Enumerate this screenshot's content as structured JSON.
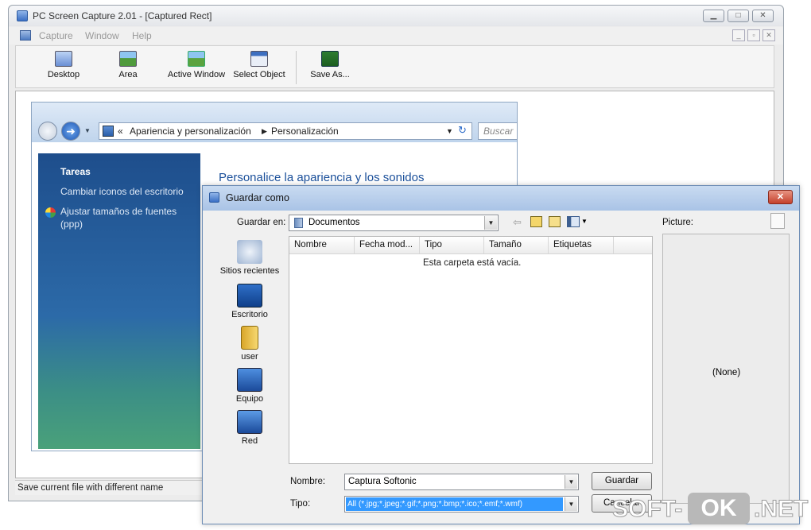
{
  "app": {
    "title": "PC Screen Capture 2.01 - [Captured Rect]",
    "menu": [
      "Capture",
      "Window",
      "Help"
    ],
    "toolbar": {
      "desktop": "Desktop",
      "area": "Area",
      "active_window": "Active Window",
      "select_object": "Select Object",
      "save_as": "Save As..."
    },
    "status": "Save current file with different name"
  },
  "explorer": {
    "breadcrumb": [
      "Apariencia y personalización",
      "Personalización"
    ],
    "breadcrumb_prefix": "«",
    "search_placeholder": "Buscar",
    "sidebar_title": "Tareas",
    "sidebar_links": [
      "Cambiar iconos del escritorio",
      "Ajustar tamaños de fuentes",
      "(ppp)"
    ],
    "heading": "Personalice la apariencia y los sonidos"
  },
  "dialog": {
    "title": "Guardar como",
    "save_in_label": "Guardar en:",
    "save_in_value": "Documentos",
    "places": [
      "Sitios recientes",
      "Escritorio",
      "user",
      "Equipo",
      "Red"
    ],
    "columns": [
      "Nombre",
      "Fecha mod...",
      "Tipo",
      "Tamaño",
      "Etiquetas"
    ],
    "empty_message": "Esta carpeta está vacía.",
    "picture_label": "Picture:",
    "preview_value": "(None)",
    "name_label": "Nombre:",
    "name_value": "Captura Softonic",
    "type_label": "Tipo:",
    "type_value": "All (*.jpg;*.jpeg;*.gif;*.png;*.bmp;*.ico;*.emf;*.wmf)",
    "save_button": "Guardar",
    "cancel_button": "Cancelar"
  },
  "watermark": {
    "prefix": "SOFT-",
    "middle": "OK",
    "suffix": ".NET"
  },
  "colors": {
    "vista_sidebar": "#2c6aa8",
    "vista_heading": "#1a4f9a",
    "selection": "#3399ff",
    "close_red": "#c4412c"
  }
}
